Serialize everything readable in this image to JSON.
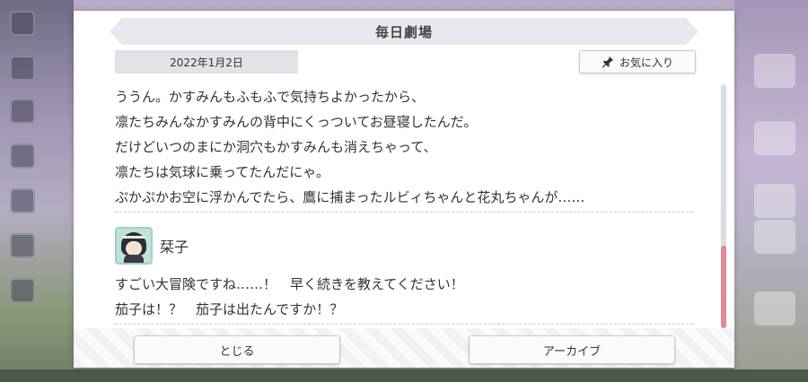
{
  "dialog": {
    "title": "毎日劇場",
    "date": "2022年1月2日",
    "favorite_label": "お気に入り",
    "story_lines": [
      "ううん。かすみんもふもふで気持ちよかったから、",
      "凛たちみんなかすみんの背中にくっついてお昼寝したんだ。",
      "だけどいつのまにか洞穴もかすみんも消えちゃって、",
      "凛たちは気球に乗ってたんだにゃ。",
      "ぷかぷかお空に浮かんでたら、鷹に捕まったルビィちゃんと花丸ちゃんが……"
    ],
    "speaker_name": "栞子",
    "reply_lines": [
      "すごい大冒険ですね……！　早く続きを教えてください！",
      "茄子は！？　茄子は出たんですか！？"
    ],
    "close_label": "とじる",
    "archive_label": "アーカイブ"
  },
  "icons": {
    "favorite": "pin-icon",
    "speaker": "character-avatar"
  },
  "colors": {
    "scroll_thumb": "#e08a93",
    "title_bar": "#e8e8ee",
    "date_box": "#e2e2e8"
  },
  "scroll_position": 0.85
}
